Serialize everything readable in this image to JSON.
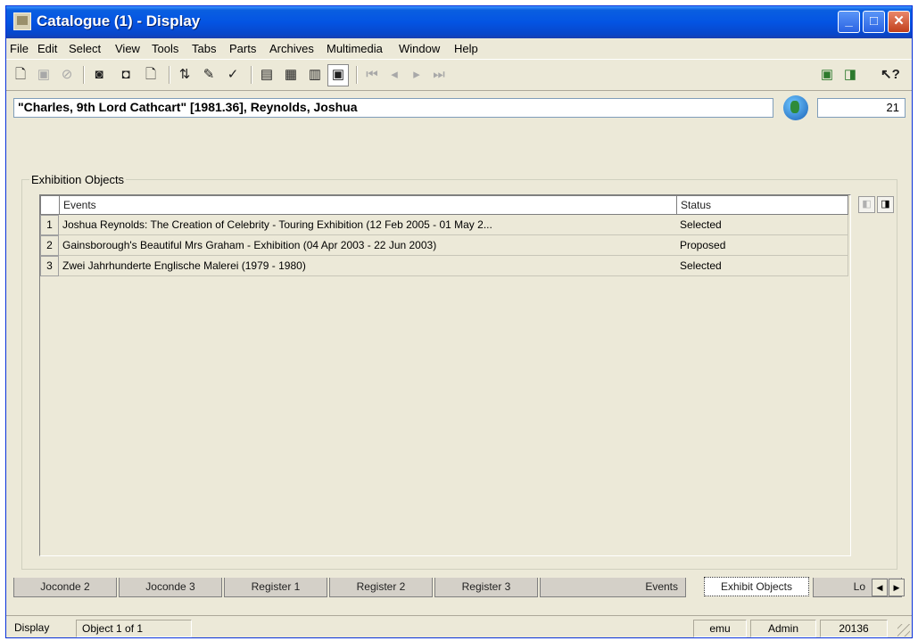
{
  "window": {
    "title": "Catalogue (1) - Display"
  },
  "menu": [
    "File",
    "Edit",
    "Select",
    "View",
    "Tools",
    "Tabs",
    "Parts",
    "Archives",
    "Multimedia",
    "Window",
    "Help"
  ],
  "record": {
    "title": "\"Charles, 9th Lord Cathcart\" [1981.36], Reynolds, Joshua",
    "count": "21"
  },
  "group": {
    "label": "Exhibition Objects"
  },
  "grid": {
    "columns": [
      "Events",
      "Status"
    ],
    "rows": [
      {
        "num": "1",
        "event": "Joshua Reynolds: The Creation of Celebrity - Touring Exhibition (12 Feb 2005 - 01 May 2...",
        "status": "Selected"
      },
      {
        "num": "2",
        "event": "Gainsborough's Beautiful Mrs Graham - Exhibition (04 Apr 2003 - 22 Jun 2003)",
        "status": "Proposed"
      },
      {
        "num": "3",
        "event": "Zwei Jahrhunderte Englische Malerei (1979 - 1980)",
        "status": "Selected"
      }
    ]
  },
  "tabs": [
    "Joconde 2",
    "Joconde 3",
    "Register 1",
    "Register 2",
    "Register 3",
    "Events",
    "Exhibit Objects",
    "Lo"
  ],
  "status": {
    "mode": "Display",
    "position": "Object 1 of 1",
    "user": "emu",
    "role": "Admin",
    "number": "20136"
  },
  "toolbar_icons": [
    "new-record-icon",
    "save-icon",
    "cancel-icon",
    "search-icon",
    "new-search-icon",
    "new-document-icon",
    "sort-icon",
    "edit-icon",
    "spellcheck-icon",
    "view-list-icon",
    "view-table-icon",
    "view-details-icon",
    "view-page-icon",
    "first-record-icon",
    "prev-record-icon",
    "next-record-icon",
    "last-record-icon",
    "report-icon",
    "attach-icon",
    "context-help-icon"
  ]
}
